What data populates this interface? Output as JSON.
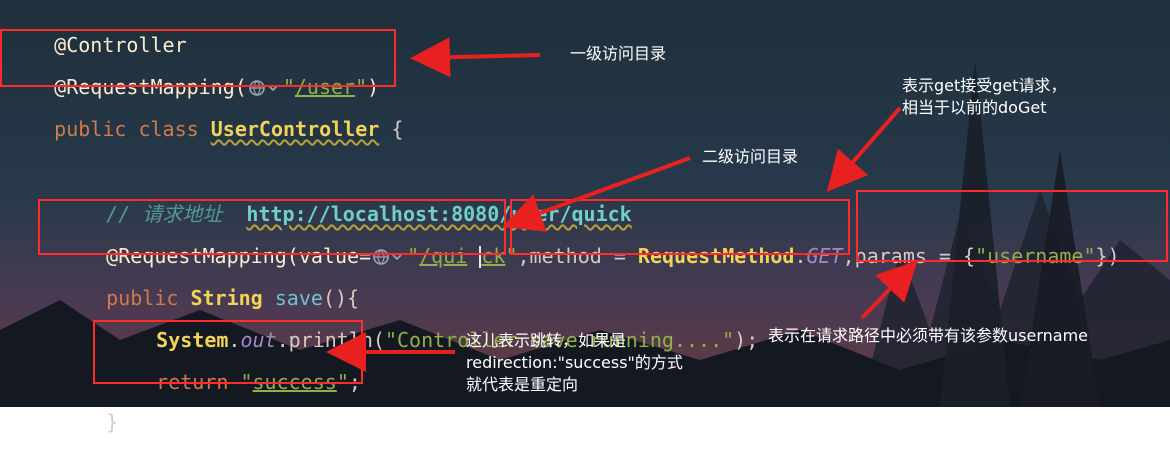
{
  "code": {
    "line1": {
      "annotation": "@Controller"
    },
    "line2": {
      "annotation": "@RequestMapping(",
      "quote_open": "\"",
      "path": "/user",
      "quote_close": "\"",
      "close": ")"
    },
    "line3": {
      "kw1": "public",
      "kw2": "class",
      "class_name": "UserController",
      "brace": "{"
    },
    "line4": {
      "slashes": "//",
      "label": "请求地址",
      "url": "http://localhost:8080/user/quick"
    },
    "line5": {
      "annotation": "@RequestMapping(value=",
      "quote_open": "\"",
      "path_a": "/qui",
      "path_b": "ck",
      "quote_close": "\"",
      "comma1": ",",
      "method_key": "method = ",
      "enum_class": "RequestMethod",
      "dot": ".",
      "enum_value": "GET",
      "comma2": ",",
      "params_key": "params = {",
      "params_value": "\"username\"",
      "params_close": "})"
    },
    "line6": {
      "kw": "public",
      "type": "String",
      "method": "save",
      "rest": "(){"
    },
    "line7": {
      "class_name": "System",
      "dot1": ".",
      "field": "out",
      "call": ".println(",
      "arg": "\"Controller save running....\"",
      "end": ");"
    },
    "line8": {
      "kw": "return",
      "quote_open": "\"",
      "value": "success",
      "quote_close": "\"",
      "end": ";"
    },
    "line9": {
      "brace": "}"
    }
  },
  "annotations": {
    "level1": "一级访问目录",
    "level2": "二级访问目录",
    "get_line1": "表示get接受get请求，",
    "get_line2": "相当于以前的doGet",
    "params_note": "表示在请求路径中必须带有该参数username",
    "return_line1": "这儿表示跳转，如果是",
    "return_line2": "redirection:\"success\"的方式",
    "return_line3": "就代表是重定向"
  },
  "colors": {
    "highlight_box": "#ff2a2a",
    "arrow": "#e82020",
    "annotation_code": "#fcebd0",
    "keyword": "#d07a4e",
    "string": "#8fb04c",
    "class": "#f2d35a",
    "comment": "#4f9c8e"
  },
  "icons": {
    "inlay_hint": "globe-chevron-icon"
  }
}
